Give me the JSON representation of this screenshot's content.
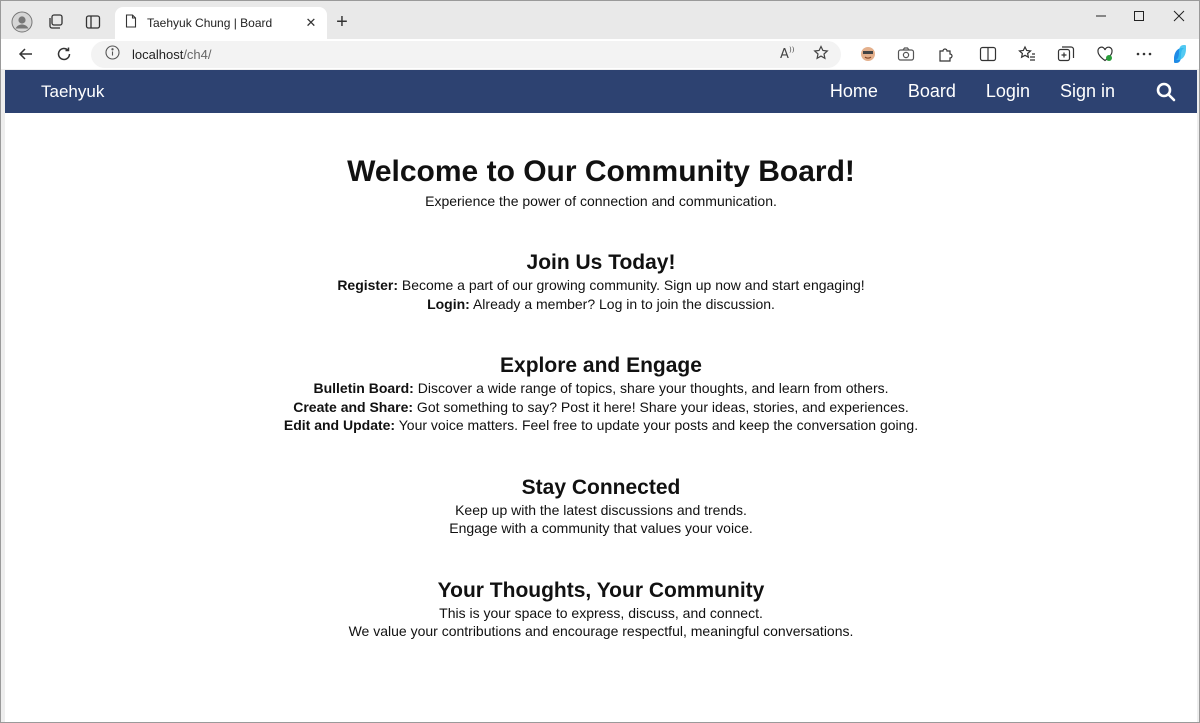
{
  "browser": {
    "tab_title": "Taehyuk Chung | Board",
    "url_host": "localhost",
    "url_path": "/ch4/"
  },
  "site": {
    "brand": "Taehyuk",
    "nav": [
      "Home",
      "Board",
      "Login",
      "Sign in"
    ],
    "nav_color": "#2d4271"
  },
  "hero": {
    "title": "Welcome to Our Community Board!",
    "subtitle": "Experience the power of connection and communication."
  },
  "sections": [
    {
      "title": "Join Us Today!",
      "lines": [
        {
          "label": "Register:",
          "text": " Become a part of our growing community. Sign up now and start engaging!"
        },
        {
          "label": "Login:",
          "text": " Already a member? Log in to join the discussion."
        }
      ]
    },
    {
      "title": "Explore and Engage",
      "lines": [
        {
          "label": "Bulletin Board:",
          "text": " Discover a wide range of topics, share your thoughts, and learn from others."
        },
        {
          "label": "Create and Share:",
          "text": " Got something to say? Post it here! Share your ideas, stories, and experiences."
        },
        {
          "label": "Edit and Update:",
          "text": " Your voice matters. Feel free to update your posts and keep the conversation going."
        }
      ]
    },
    {
      "title": "Stay Connected",
      "lines": [
        {
          "label": "",
          "text": "Keep up with the latest discussions and trends."
        },
        {
          "label": "",
          "text": "Engage with a community that values your voice."
        }
      ]
    },
    {
      "title": "Your Thoughts, Your Community",
      "lines": [
        {
          "label": "",
          "text": "This is your space to express, discuss, and connect."
        },
        {
          "label": "",
          "text": "We value your contributions and encourage respectful, meaningful conversations."
        }
      ]
    }
  ],
  "icons": {
    "profile": "profile-icon",
    "workspaces": "workspaces-icon",
    "tab_actions": "vertical-tabs-icon",
    "page": "page-icon",
    "close": "close-icon",
    "new_tab": "plus-icon",
    "minimize": "minimize-icon",
    "maximize": "maximize-icon",
    "window_close": "window-close-icon",
    "back": "back-arrow-icon",
    "refresh": "refresh-icon",
    "info": "info-icon",
    "read_aloud": "read-aloud-icon",
    "favorite": "star-icon",
    "search": "search-icon"
  }
}
